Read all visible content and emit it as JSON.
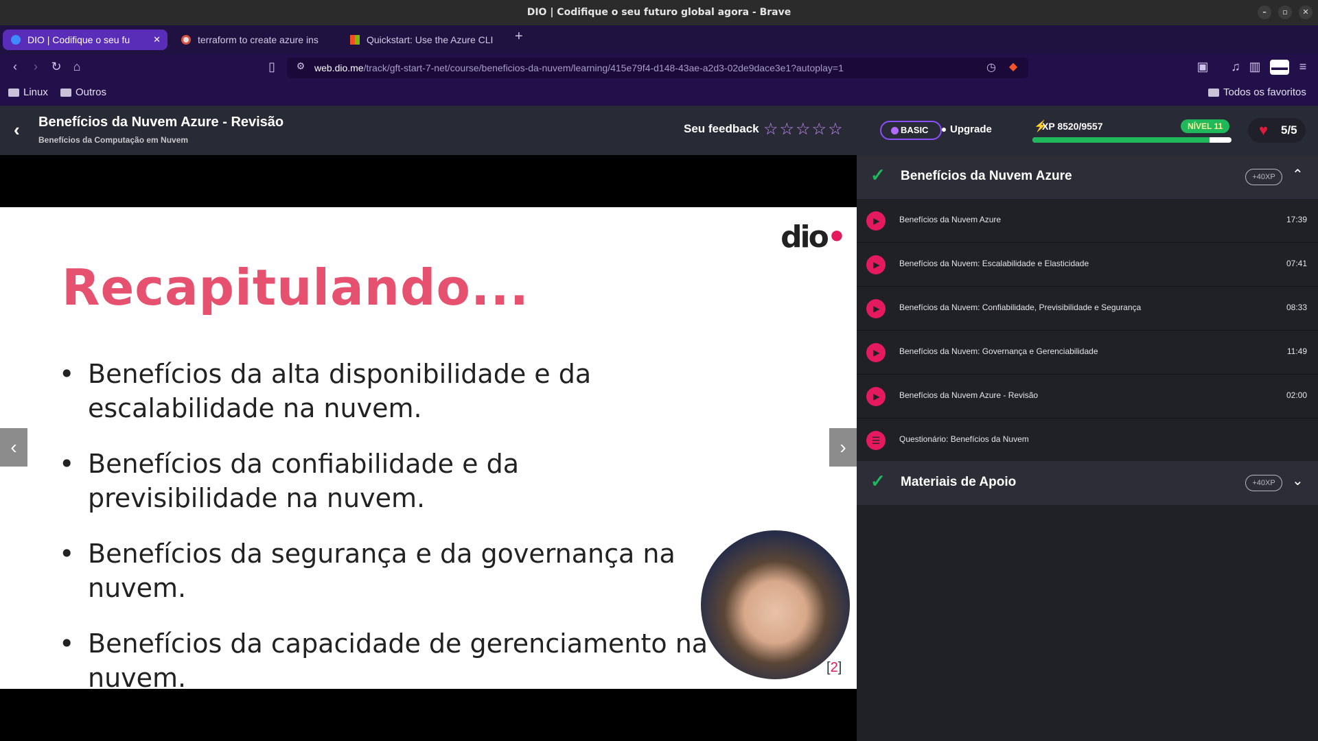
{
  "window": {
    "title": "DIO | Codifique o seu futuro global agora - Brave"
  },
  "tabs": [
    {
      "label": "DIO | Codifique o seu fu",
      "active": true
    },
    {
      "label": "terraform to create azure ins",
      "active": false
    },
    {
      "label": "Quickstart: Use the Azure CLI",
      "active": false
    }
  ],
  "address": {
    "host": "web.dio.me",
    "path": "/track/gft-start-7-net/course/beneficios-da-nuvem/learning/415e79f4-d148-43ae-a2d3-02de9dace3e1?autoplay=1"
  },
  "bookmarks": {
    "items": [
      "Linux",
      "Outros"
    ],
    "all": "Todos os favoritos"
  },
  "header": {
    "title": "Benefícios da Nuvem Azure - Revisão",
    "subtitle": "Benefícios da Computação em Nuvem",
    "feedback_label": "Seu feedback",
    "stars": "☆☆☆☆☆",
    "plan": "BASIC",
    "upgrade": "Upgrade",
    "xp": "XP 8520/9557",
    "xp_progress": 0.89,
    "level": "NÍVEL 11",
    "lives": "5/5"
  },
  "slide": {
    "logo": "dio",
    "headline": "Recapitulando...",
    "bullets": [
      "Benefícios da alta disponibilidade e da escalabilidade na nuvem.",
      "Benefícios da confiabilidade e da previsibilidade na nuvem.",
      "Benefícios da segurança e da governança na nuvem.",
      "Benefícios da capacidade de gerenciamento na nuvem."
    ],
    "page_open": "[",
    "page": "2",
    "page_close": "]"
  },
  "panel": {
    "section1": {
      "title": "Benefícios da Nuvem Azure",
      "xp": "+40XP"
    },
    "lessons": [
      {
        "label": "Benefícios da Nuvem Azure",
        "duration": "17:39",
        "icon": "play-icon"
      },
      {
        "label": "Benefícios da Nuvem: Escalabilidade e Elasticidade",
        "duration": "07:41",
        "icon": "play-icon"
      },
      {
        "label": "Benefícios da Nuvem: Confiabilidade, Previsibilidade e Segurança",
        "duration": "08:33",
        "icon": "play-icon"
      },
      {
        "label": "Benefícios da Nuvem: Governança e Gerenciabilidade",
        "duration": "11:49",
        "icon": "play-icon"
      },
      {
        "label": "Benefícios da Nuvem Azure - Revisão",
        "duration": "02:00",
        "icon": "play-icon"
      },
      {
        "label": "Questionário: Benefícios da Nuvem",
        "duration": "",
        "icon": "list-icon"
      }
    ],
    "section2": {
      "title": "Materiais de Apoio",
      "xp": "+40XP"
    }
  },
  "colors": {
    "accent": "#e5195e",
    "brand_purple": "#5a2db8",
    "success": "#1fb85a"
  }
}
